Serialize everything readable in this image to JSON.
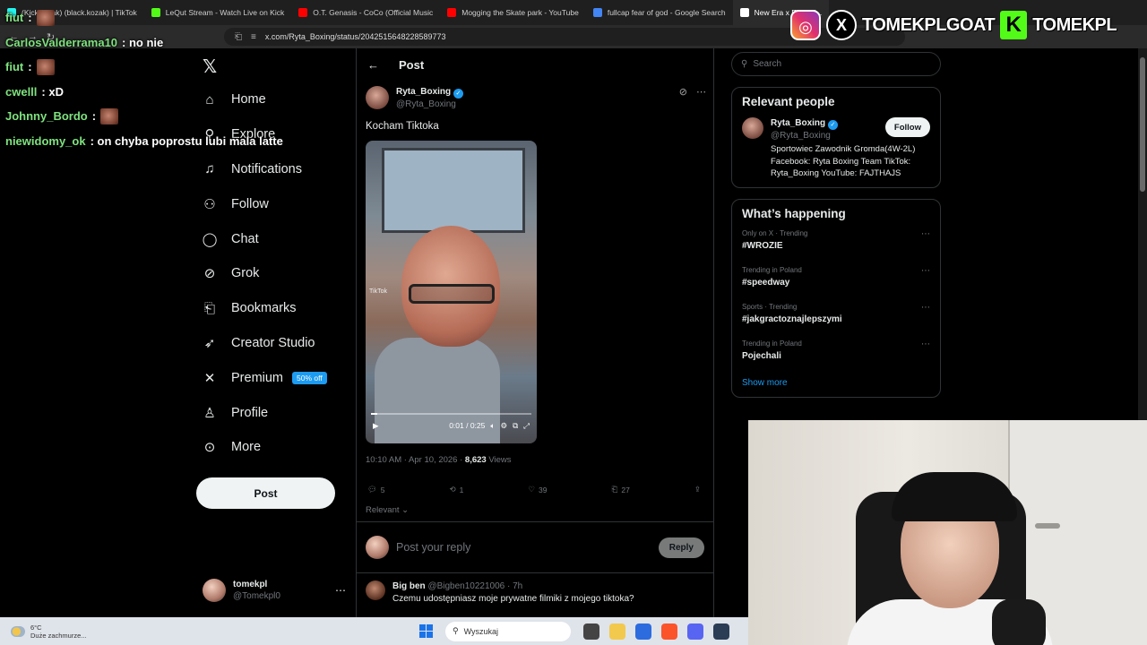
{
  "browser": {
    "tabs": [
      {
        "label": "(KickKozak) (black.kozak) | TikTok",
        "color": "#25f4ee"
      },
      {
        "label": "LeQut Stream - Watch Live on Kick",
        "color": "#53fc18"
      },
      {
        "label": "O.T. Genasis - CoCo (Official Music",
        "color": "#ff0000"
      },
      {
        "label": "Mogging the Skate park - YouTube",
        "color": "#ff0000"
      },
      {
        "label": "fullcap fear of god - Google Search",
        "color": "#4285f4"
      },
      {
        "label": "New Era x Fear of...",
        "color": "#ffffff"
      }
    ],
    "url": "x.com/Ryta_Boxing/status/2042515648228589773"
  },
  "chat": [
    {
      "user": "fiut",
      "message": ":",
      "emote": true
    },
    {
      "user": "CarlosValderrama10",
      "message": ": no nie",
      "emote": false
    },
    {
      "user": "fiut",
      "message": ":",
      "emote": true
    },
    {
      "user": "cwelll",
      "message": ": xD",
      "emote": false
    },
    {
      "user": "Johnny_Bordo",
      "message": ":",
      "emote": true
    },
    {
      "user": "niewidomy_ok",
      "message": ": on chyba poprostu lubi mala latte",
      "emote": false
    }
  ],
  "banner": {
    "handle_x": "TOMEKPLGOAT",
    "kick_letter": "K",
    "handle_kick": "TOMEKPL"
  },
  "sidebar": {
    "items": [
      {
        "label": "Home",
        "icon": "home-icon",
        "glyph": "⌂"
      },
      {
        "label": "Explore",
        "icon": "search-icon",
        "glyph": "⚲"
      },
      {
        "label": "Notifications",
        "icon": "bell-icon",
        "glyph": "🔔︎"
      },
      {
        "label": "Follow",
        "icon": "add-user-icon",
        "glyph": "⚇"
      },
      {
        "label": "Chat",
        "icon": "chat-icon",
        "glyph": "◯"
      },
      {
        "label": "Grok",
        "icon": "grok-icon",
        "glyph": "⊘"
      },
      {
        "label": "Bookmarks",
        "icon": "bookmark-icon",
        "glyph": "⎗"
      },
      {
        "label": "Creator Studio",
        "icon": "rocket-icon",
        "glyph": "➶"
      },
      {
        "label": "Premium",
        "icon": "x-icon",
        "glyph": "𝕏"
      },
      {
        "label": "Profile",
        "icon": "person-icon",
        "glyph": "⚲"
      },
      {
        "label": "More",
        "icon": "more-circle-icon",
        "glyph": "⊙"
      }
    ],
    "premium_badge": "50% off",
    "post_label": "Post",
    "account": {
      "name": "tomekpl",
      "handle": "@Tomekpl0"
    }
  },
  "main": {
    "header": "Post",
    "author": {
      "name": "Ryta_Boxing",
      "handle": "@Ryta_Boxing"
    },
    "text": "Kocham Tiktoka",
    "video": {
      "watermark": "TikTok",
      "time": "0:01 / 0:25",
      "progress": 0.04
    },
    "timestamp": "10:10 AM · Apr 10, 2026 · ",
    "views_count": "8,623",
    "views_label": " Views",
    "stats": {
      "replies": "5",
      "reposts": "1",
      "likes": "39",
      "bookmarks": "27"
    },
    "sort": "Relevant ⌄",
    "reply_placeholder": "Post your reply",
    "reply_button": "Reply",
    "comment": {
      "name": "Big ben",
      "handle": "@Bigben10221006 · 7h",
      "text": "Czemu udostępniasz moje prywatne filmiki z mojego tiktoka?"
    }
  },
  "right": {
    "search_placeholder": "Search",
    "relevant_title": "Relevant people",
    "person": {
      "name": "Ryta_Boxing",
      "handle": "@Ryta_Boxing",
      "follow": "Follow",
      "bio": "Sportowiec Zawodnik Gromda(4W-2L) Facebook: Ryta Boxing Team TikTok: Ryta_Boxing YouTube: FAJTHAJS"
    },
    "happening_title": "What’s happening",
    "trends": [
      {
        "context": "Only on X · Trending",
        "name": "#WROZIE"
      },
      {
        "context": "Trending in Poland",
        "name": "#speedway"
      },
      {
        "context": "Sports · Trending",
        "name": "#jakgractoznajlepszymi"
      },
      {
        "context": "Trending in Poland",
        "name": "Pojechali"
      }
    ],
    "show_more": "Show more"
  },
  "taskbar": {
    "temp": "6°C",
    "weather": "Duże zachmurze...",
    "search": "Wyszukaj"
  }
}
